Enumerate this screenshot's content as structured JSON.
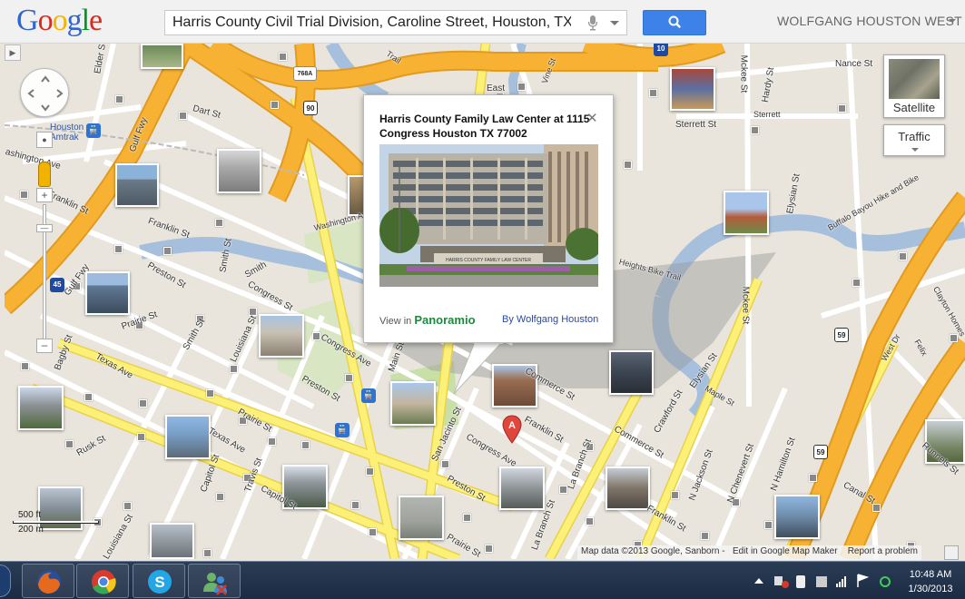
{
  "header": {
    "logo_letters": [
      "G",
      "o",
      "o",
      "g",
      "l",
      "e"
    ],
    "logo_colors": [
      "#3366cc",
      "#d62d20",
      "#f4b400",
      "#3366cc",
      "#009925",
      "#d62d20"
    ],
    "search_value": "Harris County Civil Trial Division, Caroline Street, Houston, TX",
    "search_button_icon": "search-icon",
    "user_name": "WOLFGANG HOUSTON WEST"
  },
  "map_controls": {
    "satellite_label": "Satellite",
    "traffic_label": "Traffic"
  },
  "info_window": {
    "title": "Harris County Family Law Center at 1115 Congress Houston TX 77002",
    "photo_sign_text": "HARRIS COUNTY FAMILY LAW CENTER",
    "view_in_label": "View in",
    "panoramio_label": "Panoramio",
    "by_label": "By Wolfgang Houston"
  },
  "marker_label": "A",
  "highway_shields": {
    "i10": "10",
    "us90": "90",
    "tx768a": "768A",
    "i45": "45",
    "us59a": "59",
    "us59b": "59"
  },
  "streets": {
    "elder": "Elder St",
    "gulf_fwy_1": "Gulf Fwy",
    "gulf_fwy_2": "Gulf Fwy",
    "dart": "Dart St",
    "houston_amtrak": "Houston Amtrak",
    "washington_ave_1": "Washington Ave",
    "washington_ave_2": "Washington Ave",
    "franklin_1": "Franklin St",
    "franklin_2": "Franklin St",
    "franklin_3": "Franklin St",
    "franklin_4": "Franklin St",
    "preston_1": "Preston St",
    "preston_2": "Preston St",
    "preston_3": "Preston St",
    "congress_1": "Congress St",
    "congress_2": "Congress Ave",
    "congress_3": "Congress Ave",
    "smith_1": "Smith St",
    "smith_2": "Smith",
    "smith_3": "Smith St",
    "louisiana_1": "Louisiana St",
    "louisiana_2": "Louisiana St",
    "prairie_1": "Prairie St",
    "prairie_2": "Prairie St",
    "prairie_3": "Prairie St",
    "texas_1": "Texas Ave",
    "texas_2": "Texas Ave",
    "bagby": "Bagby St",
    "rusk": "Rusk St",
    "capitol_1": "Capitol St",
    "capitol_2": "Capitol St",
    "travis": "Travis St",
    "main": "Main St",
    "san_jacinto": "San Jacinto St",
    "la_branch_1": "La Branch St",
    "la_branch_2": "La Branch St",
    "crawford": "Crawford St",
    "commerce_1": "Commerce St",
    "commerce_2": "Commerce St",
    "elysian_1": "Elysian St",
    "elysian_2": "Elysian St",
    "mckee_1": "Mckee St",
    "mckee_2": "Mckee St",
    "hardy": "Hardy St",
    "sterrett_1": "Sterrett St",
    "sterrett_2": "Sterrett",
    "nance": "Nance St",
    "buffalo_bayou": "Buffalo Bayou Hike and Bike",
    "heights_bike": "Heights Bike Trail",
    "n_jackson": "N Jackson St",
    "n_chenevert": "N Chenevert St",
    "n_hamilton": "N Hamilton St",
    "canal": "Canal St",
    "maple": "Maple St",
    "runnels": "Runnels St",
    "clayton": "Clayton Homes",
    "felix": "Felix",
    "west_dr": "West Dr",
    "east": "East",
    "vine": "Vine St",
    "trail": "Trail",
    "washington_short": "ashington Ave",
    "st_short": "St"
  },
  "scale": {
    "ft": "500 ft",
    "m": "200 m"
  },
  "attribution": {
    "map_data": "Map data ©2013 Google, Sanborn -",
    "edit": "Edit in Google Map Maker",
    "report": "Report a problem"
  },
  "taskbar": {
    "apps": [
      "firefox-icon",
      "chrome-icon",
      "skype-icon",
      "people-icon"
    ],
    "clock_time": "10:48 AM",
    "clock_date": "1/30/2013"
  },
  "colors": {
    "freeway": "#f7b234",
    "freeway_edge": "#e29a1f",
    "arterial": "#fdf077",
    "street": "#ffffff",
    "water": "#a5bfdd",
    "park": "#c8dfa8",
    "land": "#e9e5dc",
    "search_button": "#3d82e8"
  }
}
